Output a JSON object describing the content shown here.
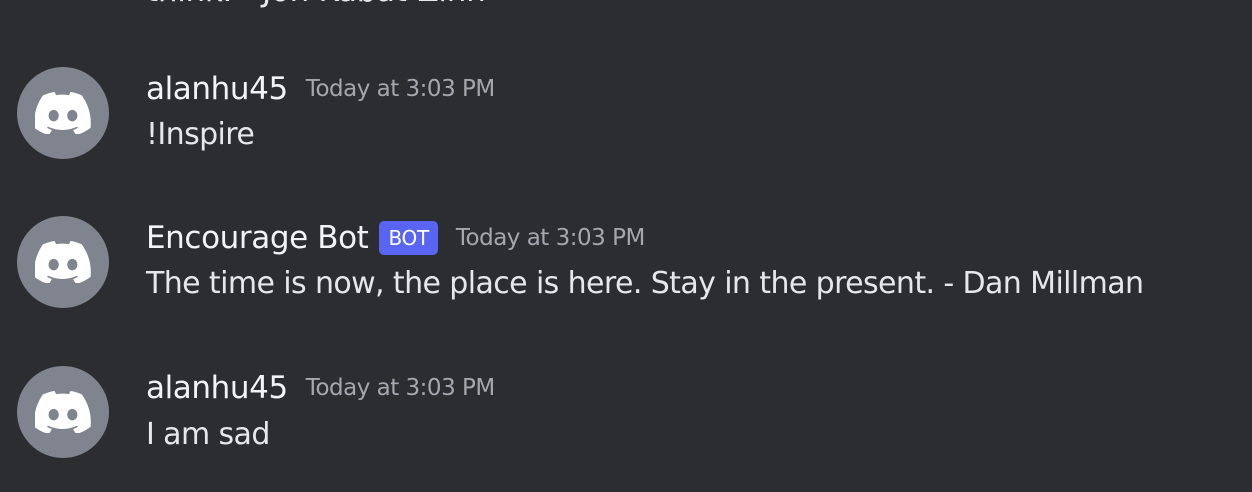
{
  "partial_message_text": "think. - Jon Kabat-Zinn",
  "messages": [
    {
      "username": "alanhu45",
      "timestamp": "Today at 3:03 PM",
      "text": "!Inspire",
      "avatar_icon": "discord-logo-icon"
    },
    {
      "username": "Encourage Bot",
      "tag": "BOT",
      "timestamp": "Today at 3:03 PM",
      "text": "The time is now, the place is here. Stay in the present. - Dan Millman",
      "avatar_icon": "discord-logo-icon"
    },
    {
      "username": "alanhu45",
      "timestamp": "Today at 3:03 PM",
      "text": "I am sad",
      "avatar_icon": "discord-logo-icon"
    }
  ],
  "colors": {
    "background": "#2b2d31",
    "avatar": "#80848e",
    "bot_tag": "#5865f2",
    "timestamp": "#a4a7ad"
  }
}
